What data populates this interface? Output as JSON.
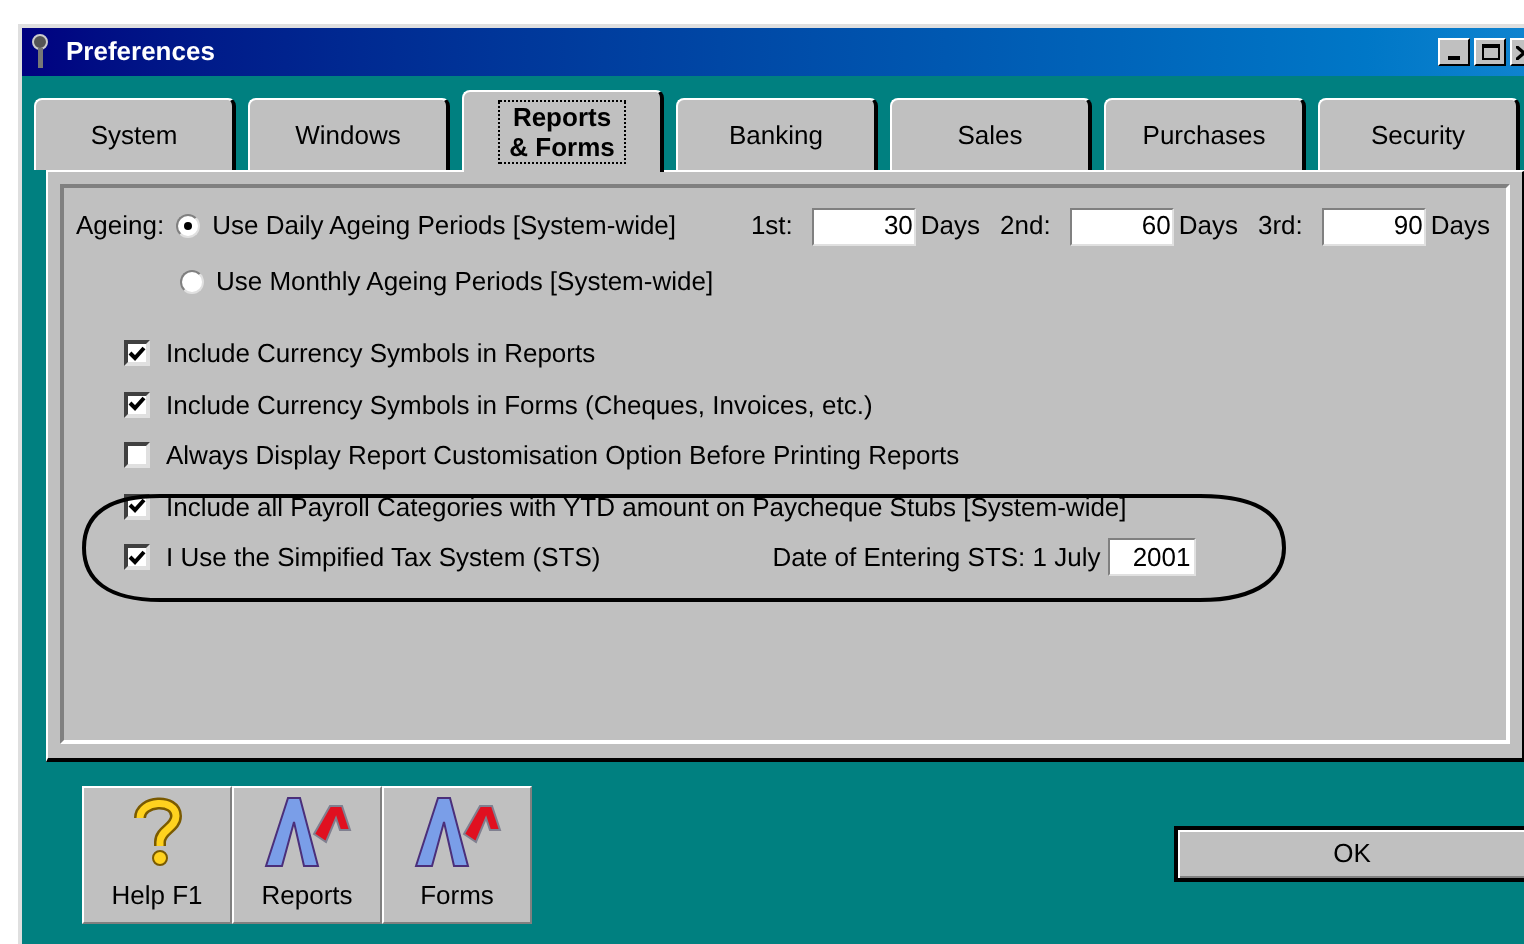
{
  "window": {
    "title": "Preferences"
  },
  "tabs": [
    {
      "label": "System",
      "selected": false
    },
    {
      "label": "Windows",
      "selected": false
    },
    {
      "label": "Reports & Forms",
      "selected": true
    },
    {
      "label": "Banking",
      "selected": false
    },
    {
      "label": "Sales",
      "selected": false
    },
    {
      "label": "Purchases",
      "selected": false
    },
    {
      "label": "Security",
      "selected": false
    }
  ],
  "ageing": {
    "label": "Ageing:",
    "options": [
      {
        "label": "Use Daily Ageing Periods [System-wide]",
        "selected": true
      },
      {
        "label": "Use Monthly Ageing Periods [System-wide]",
        "selected": false
      }
    ],
    "periods": [
      {
        "label": "1st:",
        "value": "30",
        "unit": "Days"
      },
      {
        "label": "2nd:",
        "value": "60",
        "unit": "Days"
      },
      {
        "label": "3rd:",
        "value": "90",
        "unit": "Days"
      }
    ]
  },
  "options": [
    {
      "label": "Include Currency Symbols in Reports",
      "checked": true
    },
    {
      "label": "Include Currency Symbols in Forms (Cheques, Invoices, etc.)",
      "checked": true
    },
    {
      "label": "Always Display Report Customisation Option Before Printing Reports",
      "checked": false
    },
    {
      "label": "Include all Payroll Categories with YTD amount on Paycheque Stubs [System-wide]",
      "checked": true
    },
    {
      "label": "I Use the Simpified Tax System (STS)",
      "checked": true
    }
  ],
  "sts_date": {
    "label": "Date of Entering STS: 1 July",
    "value": "2001"
  },
  "toolbar": [
    {
      "label": "Help F1",
      "kind": "help"
    },
    {
      "label": "Reports",
      "kind": "letters"
    },
    {
      "label": "Forms",
      "kind": "letters"
    }
  ],
  "ok_button": {
    "label": "OK"
  }
}
